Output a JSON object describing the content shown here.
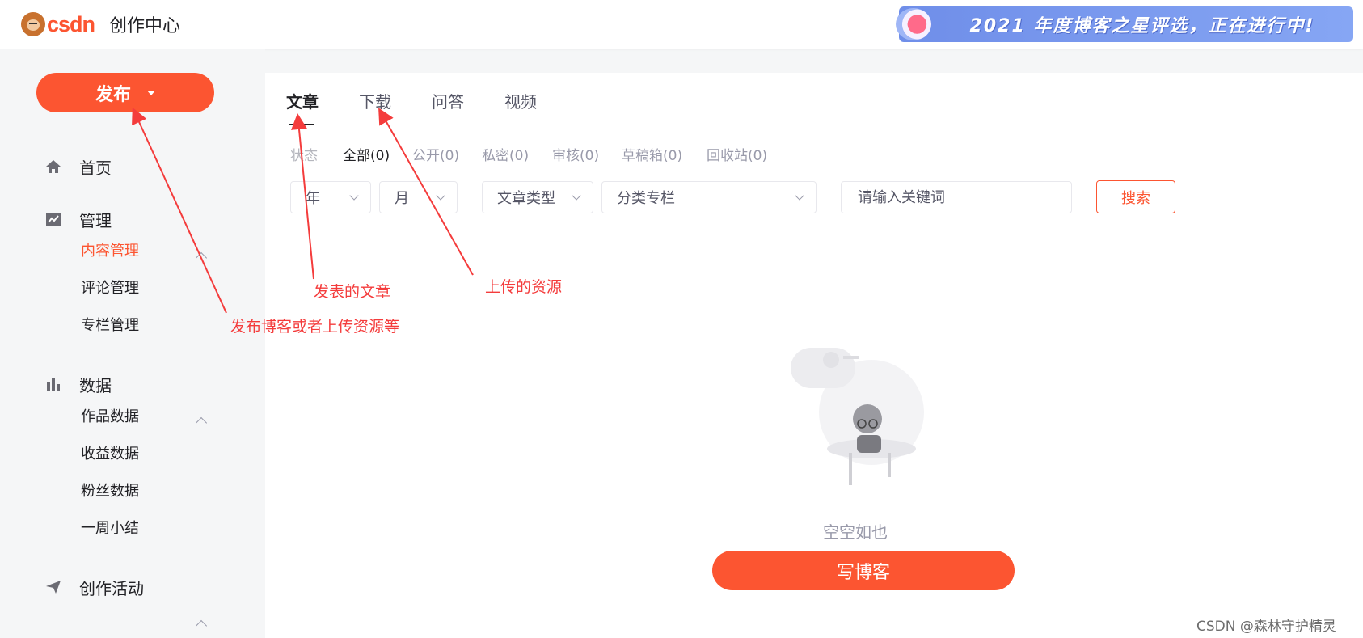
{
  "header": {
    "logo_text": "csdn",
    "title": "创作中心",
    "banner_text": "2021 年度博客之星评选，正在进行中!"
  },
  "sidebar": {
    "publish_label": "发布",
    "home": "首页",
    "manage": "管理",
    "manage_items": [
      "内容管理",
      "评论管理",
      "专栏管理"
    ],
    "data": "数据",
    "data_items": [
      "作品数据",
      "收益数据",
      "粉丝数据",
      "一周小结"
    ],
    "activity": "创作活动"
  },
  "main": {
    "tabs": [
      "文章",
      "下载",
      "问答",
      "视频"
    ],
    "filters": {
      "label": "状态",
      "items": [
        "全部(0)",
        "公开(0)",
        "私密(0)",
        "审核(0)",
        "草稿箱(0)",
        "回收站(0)"
      ]
    },
    "selects": {
      "year": "年",
      "month": "月",
      "article_type": "文章类型",
      "column": "分类专栏"
    },
    "search_placeholder": "请输入关键词",
    "search_button": "搜索",
    "empty_text": "空空如也",
    "write_button": "写博客"
  },
  "annotations": {
    "publish": "发布博客或者上传资源等",
    "articles": "发表的文章",
    "resources": "上传的资源"
  },
  "watermark": "CSDN @森林守护精灵",
  "colors": {
    "accent": "#fc5531",
    "annotation": "#f43c3c"
  }
}
